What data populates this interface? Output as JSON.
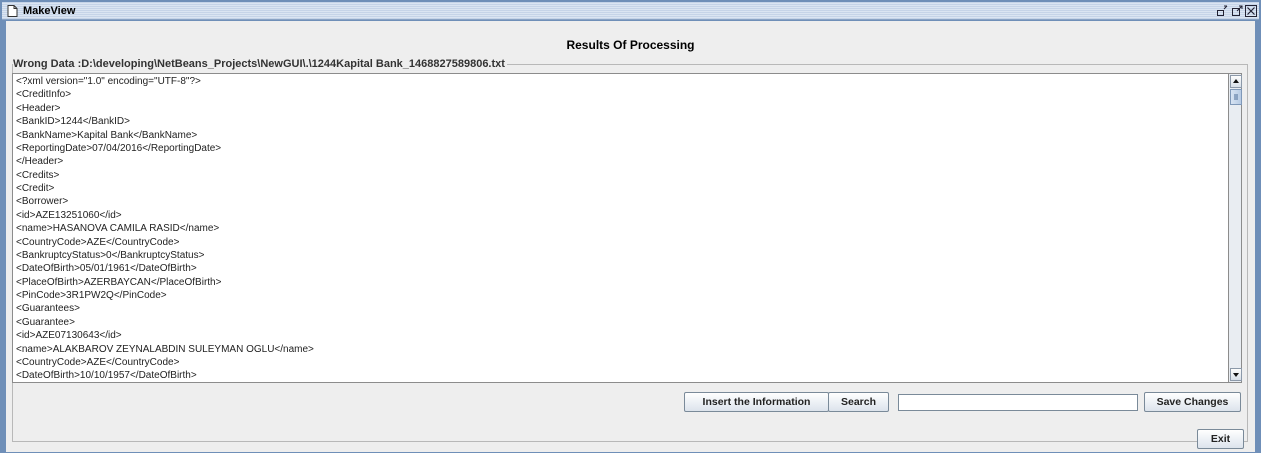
{
  "window": {
    "title": "MakeView"
  },
  "header": {
    "title": "Results Of Processing"
  },
  "group": {
    "title": "Wrong Data  :D:\\developing\\NetBeans_Projects\\NewGUI\\.\\1244Kapital Bank_1468827589806.txt"
  },
  "text_area": {
    "lines": [
      "<?xml version=\"1.0\" encoding=\"UTF-8\"?>",
      "<CreditInfo>",
      "<Header>",
      "<BankID>1244</BankID>",
      "<BankName>Kapital Bank</BankName>",
      "<ReportingDate>07/04/2016</ReportingDate>",
      "</Header>",
      "<Credits>",
      "<Credit>",
      "<Borrower>",
      "<id>AZE13251060</id>",
      "<name>HASANOVA CAMILA RASID</name>",
      "<CountryCode>AZE</CountryCode>",
      "<BankruptcyStatus>0</BankruptcyStatus>",
      "<DateOfBirth>05/01/1961</DateOfBirth>",
      "<PlaceOfBirth>AZERBAYCAN</PlaceOfBirth>",
      "<PinCode>3R1PW2Q</PinCode>",
      "<Guarantees>",
      "<Guarantee>",
      "<id>AZE07130643</id>",
      "<name>ALAKBAROV ZEYNALABDIN SULEYMAN OGLU</name>",
      "<CountryCode>AZE</CountryCode>",
      "<DateOfBirth>10/10/1957</DateOfBirth>"
    ]
  },
  "toolbar": {
    "insert_label": "Insert the Information",
    "search_label": "Search",
    "search_value": "",
    "save_label": "Save Changes"
  },
  "footer": {
    "exit_label": "Exit"
  },
  "icons": {
    "app": "document-icon",
    "minimize": "minimize-icon",
    "maximize": "maximize-icon",
    "close": "close-icon",
    "scroll_up": "arrow-up-icon",
    "scroll_down": "arrow-down-icon"
  }
}
